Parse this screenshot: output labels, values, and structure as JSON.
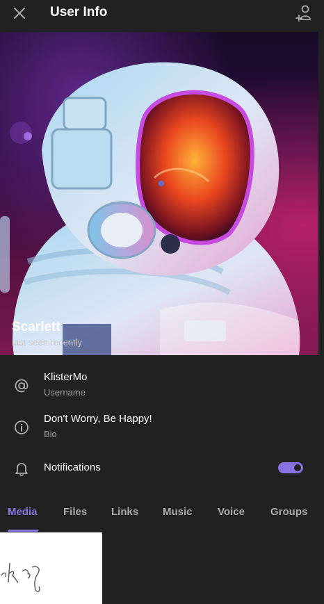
{
  "header": {
    "title": "User Info",
    "close_icon": "close-icon",
    "add_contact_icon": "add-contact-icon"
  },
  "profile": {
    "name": "Scarlett",
    "status": "last seen recently"
  },
  "info": {
    "username": {
      "value": "KlisterMo",
      "label": "Username",
      "icon": "at-icon"
    },
    "bio": {
      "value": "Don't Worry, Be Happy!",
      "label": "Bio",
      "icon": "info-icon"
    },
    "notifications": {
      "label": "Notifications",
      "icon": "bell-icon",
      "enabled": true
    }
  },
  "tabs": [
    {
      "label": "Media",
      "active": true
    },
    {
      "label": "Files",
      "active": false
    },
    {
      "label": "Links",
      "active": false
    },
    {
      "label": "Music",
      "active": false
    },
    {
      "label": "Voice",
      "active": false
    },
    {
      "label": "Groups",
      "active": false
    }
  ],
  "colors": {
    "background": "#212121",
    "accent": "#8774e1",
    "text_secondary": "#9e9e9e"
  }
}
